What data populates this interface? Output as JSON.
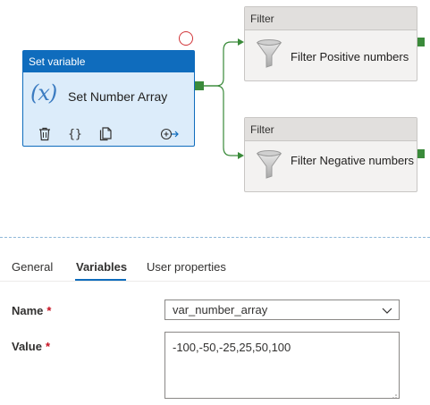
{
  "canvas": {
    "set_variable": {
      "header": "Set variable",
      "title": "Set Number Array",
      "icon": "variable-icon",
      "tools": [
        "delete-icon",
        "parameters-icon",
        "copy-icon",
        "add-output-icon"
      ]
    },
    "filters": [
      {
        "header": "Filter",
        "title": "Filter Positive numbers",
        "icon": "funnel-icon"
      },
      {
        "header": "Filter",
        "title": "Filter Negative numbers",
        "icon": "funnel-icon"
      }
    ],
    "colors": {
      "accent": "#0f6cbd",
      "success_port": "#3a8a3a",
      "error": "#d13438"
    }
  },
  "tabs": [
    {
      "label": "General",
      "active": false
    },
    {
      "label": "Variables",
      "active": true
    },
    {
      "label": "User properties",
      "active": false
    }
  ],
  "form": {
    "name_label": "Name",
    "name_required": "*",
    "name_value": "var_number_array",
    "value_label": "Value",
    "value_required": "*",
    "value_text": "-100,-50,-25,25,50,100"
  }
}
